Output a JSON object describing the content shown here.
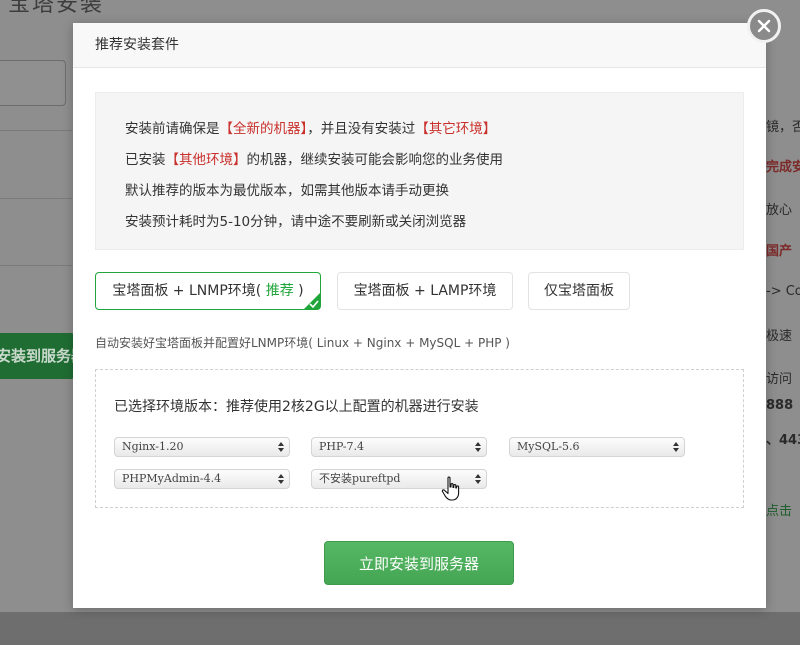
{
  "background": {
    "title": "宝塔安装",
    "green_button_label": "安装到服务器",
    "right_snippets": [
      "镜，否",
      "完成安",
      "放心",
      "国产",
      "-> Co",
      "极速",
      "访问",
      "888",
      "、443",
      "点击"
    ]
  },
  "modal": {
    "title": "推荐安装套件",
    "notice": {
      "line1_pre": "安装前请确保是",
      "line1_red1": "【全新的机器】",
      "line1_mid": "，并且没有安装过",
      "line1_red2": "【其它环境】",
      "line2_pre": "已安装",
      "line2_red": "【其他环境】",
      "line2_post": "的机器，继续安装可能会影响您的业务使用",
      "line3": "默认推荐的版本为最优版本，如需其他版本请手动更换",
      "line4": "安装预计耗时为5-10分钟，请中途不要刷新或关闭浏览器"
    },
    "tabs": [
      {
        "label": "宝塔面板 + LNMP环境(",
        "recommend": "推荐",
        "suffix": ")"
      },
      {
        "label": "宝塔面板 + LAMP环境"
      },
      {
        "label": "仅宝塔面板"
      }
    ],
    "description": "自动安装好宝塔面板并配置好LNMP环境( Linux + Nginx + MySQL + PHP )",
    "env": {
      "title": "已选择环境版本：推荐使用2核2G以上配置的机器进行安装",
      "selects": {
        "nginx": "Nginx-1.20",
        "php": "PHP-7.4",
        "mysql": "MySQL-5.6",
        "phpmyadmin": "PHPMyAdmin-4.4",
        "ftp": "不安装pureftpd"
      }
    },
    "install_button": "立即安装到服务器"
  },
  "colors": {
    "accent_green": "#20a53a",
    "warning_red": "#c9302c",
    "button_green": "#4cae5c"
  },
  "icons": [
    "close-icon",
    "checkmark-icon",
    "select-arrows-icon",
    "hand-pointer-cursor-icon"
  ]
}
